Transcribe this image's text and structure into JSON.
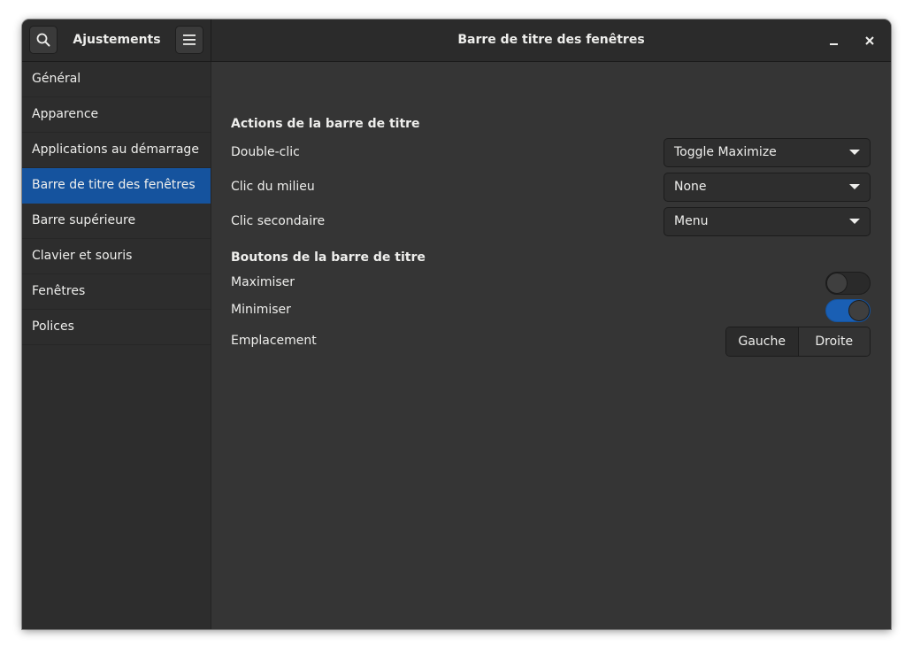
{
  "header": {
    "app_title": "Ajustements",
    "page_title": "Barre de titre des fenêtres",
    "search_icon": "search-icon",
    "menu_icon": "hamburger-menu-icon",
    "minimize_icon": "minimize-icon",
    "close_icon": "close-icon"
  },
  "sidebar": {
    "items": [
      {
        "label": "Général"
      },
      {
        "label": "Apparence"
      },
      {
        "label": "Applications au démarrage"
      },
      {
        "label": "Barre de titre des fenêtres",
        "active": true
      },
      {
        "label": "Barre supérieure"
      },
      {
        "label": "Clavier et souris"
      },
      {
        "label": "Fenêtres"
      },
      {
        "label": "Polices"
      }
    ]
  },
  "main": {
    "actions_title": "Actions de la barre de titre",
    "double_click": {
      "label": "Double-clic",
      "value": "Toggle Maximize"
    },
    "middle_click": {
      "label": "Clic du milieu",
      "value": "None"
    },
    "secondary_click": {
      "label": "Clic secondaire",
      "value": "Menu"
    },
    "buttons_title": "Boutons de la barre de titre",
    "maximize": {
      "label": "Maximiser",
      "on": false
    },
    "minimize": {
      "label": "Minimiser",
      "on": true
    },
    "placement": {
      "label": "Emplacement",
      "left": "Gauche",
      "right": "Droite",
      "selected": "Droite"
    }
  },
  "colors": {
    "accent": "#15539e",
    "switch_on": "#1a5fb4",
    "background": "#353535",
    "sidebar": "#2d2d2d",
    "text": "#eeeeec"
  }
}
